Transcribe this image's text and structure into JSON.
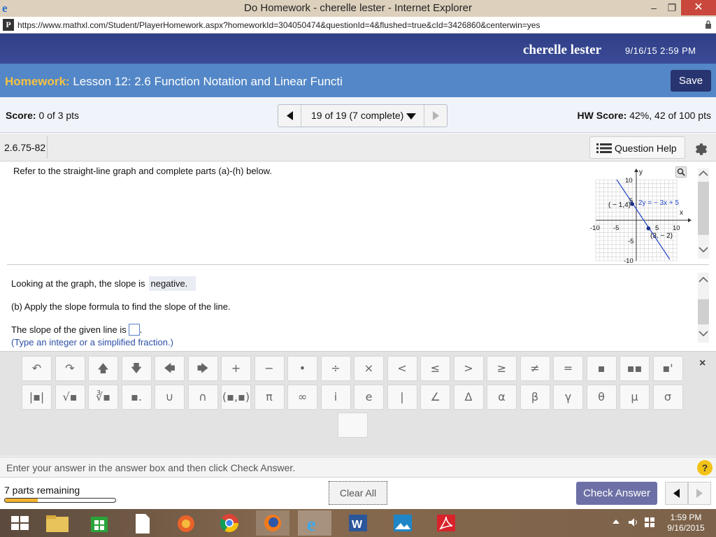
{
  "window": {
    "title": "Do Homework - cherelle lester - Internet Explorer"
  },
  "address": {
    "url": "https://www.mathxl.com/Student/PlayerHomework.aspx?homeworkId=304050474&questionId=4&flushed=true&cId=3426860&centerwin=yes"
  },
  "header": {
    "user": "cherelle lester",
    "datetime": "9/16/15 2:59 PM"
  },
  "homework": {
    "label": "Homework:",
    "title": "Lesson 12: 2.6 Function Notation and Linear Functi",
    "save": "Save"
  },
  "score": {
    "label": "Score:",
    "value": "0 of 3 pts",
    "nav": "19 of 19 (7 complete)",
    "hw_label": "HW Score:",
    "hw_value": "42%, 42 of 100 pts"
  },
  "question": {
    "id": "2.6.75-82",
    "help": "Question Help",
    "prompt": "Refer to the straight-line graph and complete parts (a)-(h) below."
  },
  "graph": {
    "equation": "2y = − 3x + 5",
    "point1": "( − 1,4)",
    "point2": "(3, − 2)",
    "x_axis": "x",
    "y_axis": "y",
    "ticks": {
      "x_neg10": "-10",
      "x_neg5": "-5",
      "x_5": "5",
      "x_10": "10",
      "y_10": "10",
      "y_5": "5",
      "y_neg5": "-5",
      "y_neg10": "-10"
    }
  },
  "parts": {
    "slope_prefix": "Looking at the graph, the slope is",
    "slope_answer": "negative.",
    "b_text": "(b) Apply the slope formula to find the slope of the line.",
    "given_prefix": "The slope of the given line is",
    "given_suffix": ".",
    "hint": "(Type an integer or a simplified fraction.)"
  },
  "palette": {
    "row1": [
      "↶",
      "↷",
      "🡅",
      "🡇",
      "🡄",
      "🡆",
      "+",
      "−",
      "•",
      "÷",
      "×",
      "<",
      "≤",
      ">",
      "≥",
      "≠",
      "=",
      "▪",
      "▪▪",
      "▪'"
    ],
    "row2": [
      "|▪|",
      "√▪",
      "∛▪",
      "▪.",
      "∪",
      "∩",
      "(▪,▪)",
      "π",
      "∞",
      "i",
      "e",
      "|",
      "∠",
      "Δ",
      "α",
      "β",
      "γ",
      "θ",
      "μ",
      "σ"
    ],
    "close": "×"
  },
  "status": {
    "text": "Enter your answer in the answer box and then click Check Answer.",
    "help": "?"
  },
  "footer": {
    "parts_remaining": "7 parts remaining",
    "progress": 0.3,
    "clear_all": "Clear All",
    "check_answer": "Check Answer"
  },
  "taskbar": {
    "time": "1:59 PM",
    "date": "9/16/2015"
  }
}
